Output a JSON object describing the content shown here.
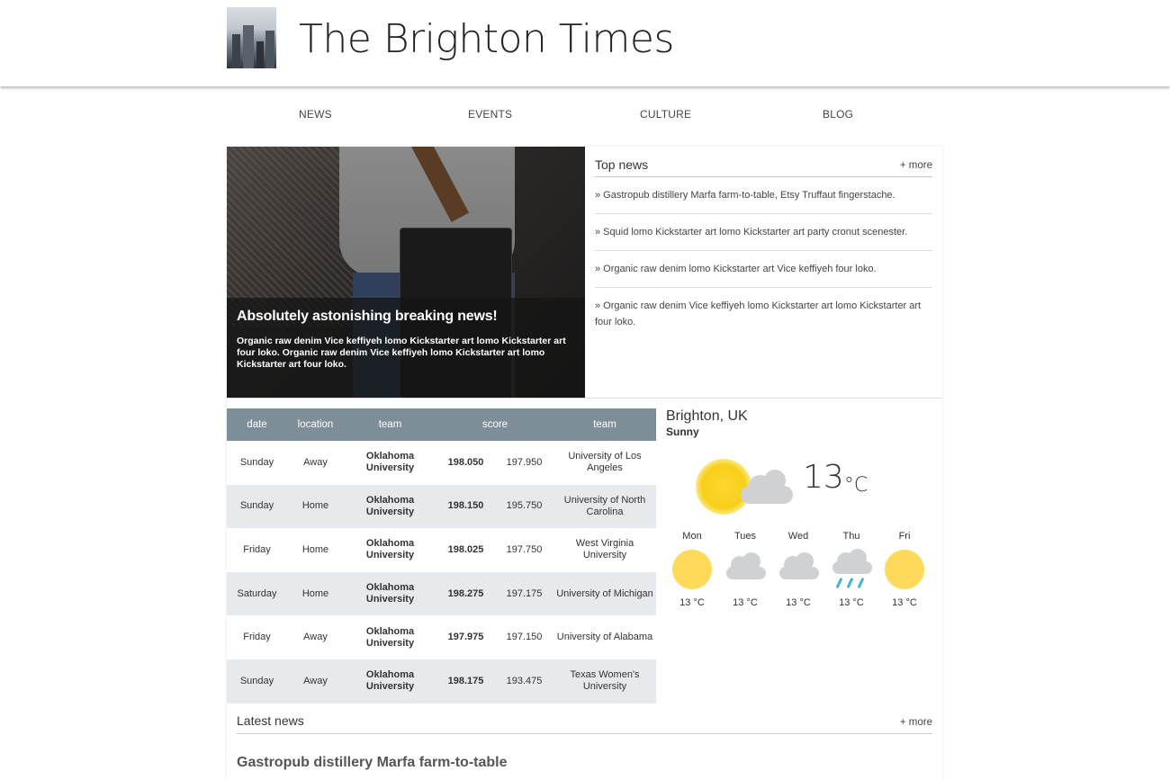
{
  "site": {
    "title": "The Brighton Times"
  },
  "nav": [
    {
      "label": "NEWS"
    },
    {
      "label": "EVENTS"
    },
    {
      "label": "CULTURE"
    },
    {
      "label": "BLOG"
    }
  ],
  "hero": {
    "headline": "Absolutely astonishing breaking news!",
    "summary": "Organic raw denim Vice keffiyeh lomo Kickstarter art lomo Kickstarter art four loko. Organic raw denim Vice keffiyeh lomo Kickstarter art lomo Kickstarter art four loko."
  },
  "top_news": {
    "title": "Top news",
    "more": "+ more",
    "items": [
      "» Gastropub distillery Marfa farm-to-table, Etsy Truffaut fingerstache.",
      "» Squid lomo Kickstarter art lomo Kickstarter art party cronut scenester.",
      "» Organic raw denim lomo Kickstarter art Vice keffiyeh four loko.",
      "» Organic raw denim Vice keffiyeh lomo Kickstarter art lomo Kickstarter art four loko."
    ]
  },
  "scores": {
    "headers": [
      "date",
      "location",
      "team",
      "score",
      "team"
    ],
    "rows": [
      {
        "date": "Sunday",
        "location": "Away",
        "team": "Oklahoma University",
        "score1": "198.050",
        "score2": "197.950",
        "opponent": "University of Los Angeles"
      },
      {
        "date": "Sunday",
        "location": "Home",
        "team": "Oklahoma University",
        "score1": "198.150",
        "score2": "195.750",
        "opponent": "University of North Carolina"
      },
      {
        "date": "Friday",
        "location": "Home",
        "team": "Oklahoma University",
        "score1": "198.025",
        "score2": "197.750",
        "opponent": "West Virginia University"
      },
      {
        "date": "Saturday",
        "location": "Home",
        "team": "Oklahoma University",
        "score1": "198.275",
        "score2": "197.175",
        "opponent": "University of Michigan"
      },
      {
        "date": "Friday",
        "location": "Away",
        "team": "Oklahoma University",
        "score1": "197.975",
        "score2": "197.150",
        "opponent": "University of Alabama"
      },
      {
        "date": "Sunday",
        "location": "Away",
        "team": "Oklahoma University",
        "score1": "198.175",
        "score2": "193.475",
        "opponent": "Texas Women's University"
      }
    ]
  },
  "weather": {
    "city": "Brighton, UK",
    "condition": "Sunny",
    "current_temp": "13",
    "unit": "°C",
    "current_icon": "sun-cloud-icon",
    "forecast": [
      {
        "day": "Mon",
        "icon": "sun-icon",
        "temp": "13 °C"
      },
      {
        "day": "Tues",
        "icon": "cloud-icon",
        "temp": "13 °C"
      },
      {
        "day": "Wed",
        "icon": "cloud-icon",
        "temp": "13 °C"
      },
      {
        "day": "Thu",
        "icon": "rain-cloud-icon",
        "temp": "13 °C"
      },
      {
        "day": "Fri",
        "icon": "sun-icon",
        "temp": "13 °C"
      }
    ]
  },
  "latest_news": {
    "title": "Latest news",
    "more": "+ more",
    "first_headline": "Gastropub distillery Marfa farm-to-table"
  },
  "colors": {
    "table_header": "#7d8e98",
    "table_stripe": "#e6eaec",
    "sun": "#ffd95a",
    "rain": "#3fb4d4"
  }
}
